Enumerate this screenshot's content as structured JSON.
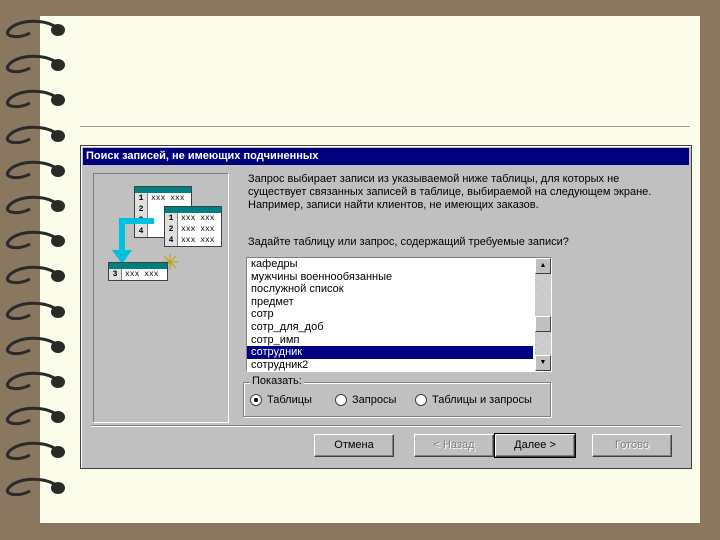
{
  "dialog": {
    "title": "Поиск записей, не имеющих подчиненных",
    "description": "Запрос выбирает записи из указываемой ниже таблицы, для которых не существует связанных записей в таблице, выбираемой на следующем экране. Например, записи найти клиентов, не имеющих заказов.",
    "prompt": "Задайте таблицу или запрос, содержащий требуемые записи?",
    "list_items": [
      "кафедры",
      "мужчины военнообязанные",
      "послужной список",
      "предмет",
      "сотр",
      "сотр_для_доб",
      "сотр_имп",
      "сотрудник",
      "сотрудник2"
    ],
    "selected_item": "сотрудник",
    "show_group": {
      "label": "Показать:",
      "options": [
        "Таблицы",
        "Запросы",
        "Таблицы и запросы"
      ],
      "selected": "Таблицы"
    },
    "buttons": {
      "cancel": "Отмена",
      "back": "< Назад",
      "next": "Далее >",
      "finish": "Готово"
    }
  },
  "illustration": {
    "table1_rows": [
      {
        "n": "1",
        "v": "xxx xxx"
      },
      {
        "n": "2",
        "v": ""
      },
      {
        "n": "3",
        "v": ""
      },
      {
        "n": "4",
        "v": ""
      }
    ],
    "table2_rows": [
      {
        "n": "1",
        "v": "xxx xxx"
      },
      {
        "n": "2",
        "v": "xxx xxx"
      },
      {
        "n": "4",
        "v": "xxx xxx"
      }
    ],
    "table3_rows": [
      {
        "n": "3",
        "v": "xxx xxx"
      }
    ]
  },
  "colors": {
    "titlebar": "#00007a",
    "selection": "#000080",
    "arrow": "#00c0e0"
  }
}
